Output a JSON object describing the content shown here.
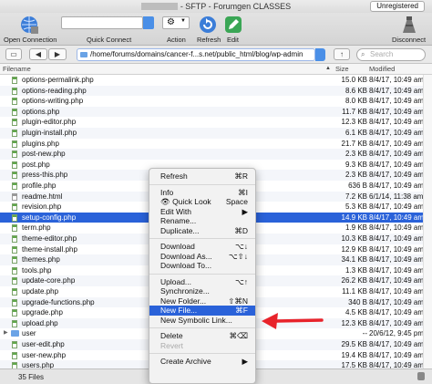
{
  "window": {
    "title": "- SFTP - Forumgen CLASSES",
    "unregistered": "Unregistered"
  },
  "toolbar": {
    "open_connection": "Open Connection",
    "quick_connect": "Quick Connect",
    "action": "Action",
    "refresh": "Refresh",
    "edit": "Edit",
    "disconnect": "Disconnect"
  },
  "pathbar": {
    "path": "/home/forums/domains/cancer-f...s.net/public_html/blog/wp-admin",
    "search_placeholder": "Search"
  },
  "columns": {
    "filename": "Filename",
    "size": "Size",
    "modified": "Modified"
  },
  "files": [
    {
      "name": "options-permalink.php",
      "size": "15.0 KB",
      "modified": "8/4/17, 10:49 am",
      "type": "php"
    },
    {
      "name": "options-reading.php",
      "size": "8.6 KB",
      "modified": "8/4/17, 10:49 am",
      "type": "php"
    },
    {
      "name": "options-writing.php",
      "size": "8.0 KB",
      "modified": "8/4/17, 10:49 am",
      "type": "php"
    },
    {
      "name": "options.php",
      "size": "11.7 KB",
      "modified": "8/4/17, 10:49 am",
      "type": "php"
    },
    {
      "name": "plugin-editor.php",
      "size": "12.3 KB",
      "modified": "8/4/17, 10:49 am",
      "type": "php"
    },
    {
      "name": "plugin-install.php",
      "size": "6.1 KB",
      "modified": "8/4/17, 10:49 am",
      "type": "php"
    },
    {
      "name": "plugins.php",
      "size": "21.7 KB",
      "modified": "8/4/17, 10:49 am",
      "type": "php"
    },
    {
      "name": "post-new.php",
      "size": "2.3 KB",
      "modified": "8/4/17, 10:49 am",
      "type": "php"
    },
    {
      "name": "post.php",
      "size": "9.3 KB",
      "modified": "8/4/17, 10:49 am",
      "type": "php"
    },
    {
      "name": "press-this.php",
      "size": "2.3 KB",
      "modified": "8/4/17, 10:49 am",
      "type": "php"
    },
    {
      "name": "profile.php",
      "size": "636 B",
      "modified": "8/4/17, 10:49 am",
      "type": "php"
    },
    {
      "name": "readme.html",
      "size": "7.2 KB",
      "modified": "6/1/14, 11:38 am",
      "type": "html"
    },
    {
      "name": "revision.php",
      "size": "5.3 KB",
      "modified": "8/4/17, 10:49 am",
      "type": "php"
    },
    {
      "name": "setup-config.php",
      "size": "14.9 KB",
      "modified": "8/4/17, 10:49 am",
      "type": "php",
      "selected": true
    },
    {
      "name": "term.php",
      "size": "1.9 KB",
      "modified": "8/4/17, 10:49 am",
      "type": "php"
    },
    {
      "name": "theme-editor.php",
      "size": "10.3 KB",
      "modified": "8/4/17, 10:49 am",
      "type": "php"
    },
    {
      "name": "theme-install.php",
      "size": "12.9 KB",
      "modified": "8/4/17, 10:49 am",
      "type": "php"
    },
    {
      "name": "themes.php",
      "size": "34.1 KB",
      "modified": "8/4/17, 10:49 am",
      "type": "php"
    },
    {
      "name": "tools.php",
      "size": "1.3 KB",
      "modified": "8/4/17, 10:49 am",
      "type": "php"
    },
    {
      "name": "update-core.php",
      "size": "26.2 KB",
      "modified": "8/4/17, 10:49 am",
      "type": "php"
    },
    {
      "name": "update.php",
      "size": "11.1 KB",
      "modified": "8/4/17, 10:49 am",
      "type": "php"
    },
    {
      "name": "upgrade-functions.php",
      "size": "340 B",
      "modified": "8/4/17, 10:49 am",
      "type": "php"
    },
    {
      "name": "upgrade.php",
      "size": "4.5 KB",
      "modified": "8/4/17, 10:49 am",
      "type": "php"
    },
    {
      "name": "upload.php",
      "size": "12.3 KB",
      "modified": "8/4/17, 10:49 am",
      "type": "php"
    },
    {
      "name": "user",
      "size": "--",
      "modified": "20/6/12, 9:45 pm",
      "type": "folder"
    },
    {
      "name": "user-edit.php",
      "size": "29.5 KB",
      "modified": "8/4/17, 10:49 am",
      "type": "php"
    },
    {
      "name": "user-new.php",
      "size": "19.4 KB",
      "modified": "8/4/17, 10:49 am",
      "type": "php"
    },
    {
      "name": "users.php",
      "size": "17.5 KB",
      "modified": "8/4/17, 10:49 am",
      "type": "php"
    }
  ],
  "status": {
    "count": "35 Files"
  },
  "context_menu": [
    {
      "label": "Refresh",
      "shortcut": "⌘R"
    },
    {
      "sep": true
    },
    {
      "label": "Info",
      "shortcut": "⌘I"
    },
    {
      "label": "Quick Look",
      "shortcut": "Space",
      "icon": "eye-icon"
    },
    {
      "label": "Edit With",
      "shortcut": "▶"
    },
    {
      "label": "Rename...",
      "shortcut": ""
    },
    {
      "label": "Duplicate...",
      "shortcut": "⌘D"
    },
    {
      "sep": true
    },
    {
      "label": "Download",
      "shortcut": "⌥↓"
    },
    {
      "label": "Download As...",
      "shortcut": "⌥⇧↓"
    },
    {
      "label": "Download To...",
      "shortcut": ""
    },
    {
      "sep": true
    },
    {
      "label": "Upload...",
      "shortcut": "⌥↑"
    },
    {
      "label": "Synchronize...",
      "shortcut": ""
    },
    {
      "label": "New Folder...",
      "shortcut": "⇧⌘N"
    },
    {
      "label": "New File...",
      "shortcut": "⌘F",
      "highlighted": true
    },
    {
      "label": "New Symbolic Link...",
      "shortcut": ""
    },
    {
      "sep": true
    },
    {
      "label": "Delete",
      "shortcut": "⌘⌫"
    },
    {
      "label": "Revert",
      "shortcut": "",
      "disabled": true
    },
    {
      "sep": true
    },
    {
      "label": "Create Archive",
      "shortcut": "▶"
    }
  ],
  "colors": {
    "selection": "#2a62d9",
    "annotation_arrow": "#e8232b"
  }
}
